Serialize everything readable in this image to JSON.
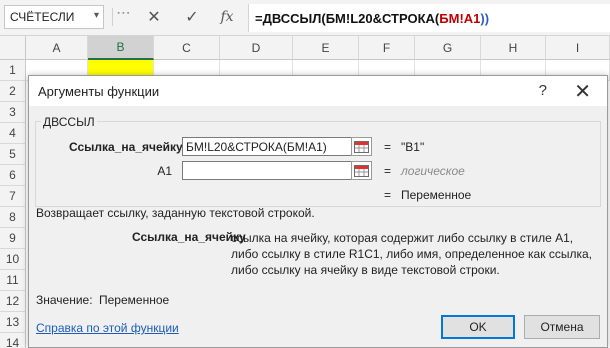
{
  "formula_bar": {
    "name_box": "СЧЁТЕСЛИ",
    "formula": {
      "prefix": "=ДВССЫЛ(БМ!L20&СТРОКА(",
      "ref": "БМ!A1",
      "suffix": "))"
    }
  },
  "sheet": {
    "columns": [
      "A",
      "B",
      "C",
      "D",
      "E",
      "F",
      "G",
      "H",
      "I"
    ],
    "rows": [
      "1",
      "2",
      "3",
      "4",
      "5",
      "6",
      "7",
      "8",
      "9",
      "10",
      "11",
      "12",
      "13",
      "14"
    ]
  },
  "dialog": {
    "title": "Аргументы функции",
    "help_glyph": "?",
    "close_glyph": "✕",
    "function_name": "ДВССЫЛ",
    "args": [
      {
        "label": "Ссылка_на_ячейку",
        "value": "БМ!L20&СТРОКА(БМ!A1)",
        "result": "\"B1\""
      },
      {
        "label": "A1",
        "value": "",
        "result": "логическое"
      }
    ],
    "equals": "=",
    "overall_result": "Переменное",
    "description": "Возвращает ссылку, заданную текстовой строкой.",
    "arg_help_name": "Ссылка_на_ячейку",
    "arg_help_text": "ссылка на ячейку, которая содержит либо ссылку в стиле A1, либо ссылку в стиле R1C1, либо имя, определенное как ссылка, либо ссылку на ячейку в виде текстовой строки.",
    "value_label": "Значение:",
    "value": "Переменное",
    "help_link": "Справка по этой функции",
    "ok_label": "OK",
    "cancel_label": "Отмена"
  },
  "colors": {
    "selected_cell": "#ffff00",
    "link": "#1b5db8",
    "formula_ref_red": "#c00000",
    "formula_ref_blue": "#2e5fb8",
    "primary_button_border": "#0078d7"
  }
}
